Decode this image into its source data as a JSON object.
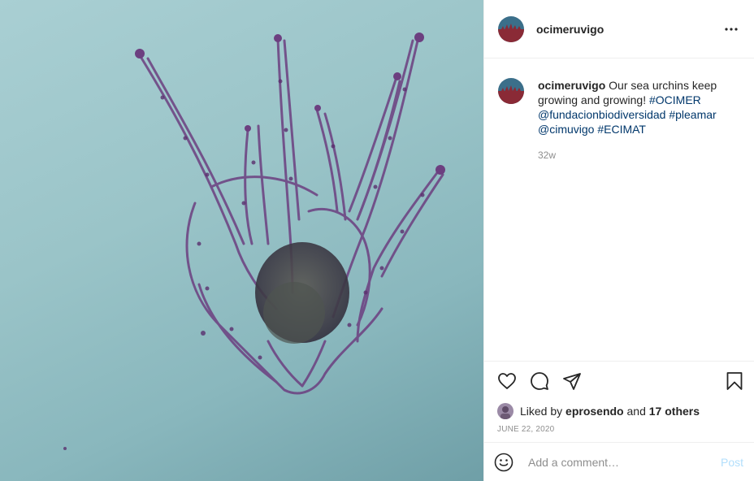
{
  "post": {
    "username": "ocimeruvigo"
  },
  "caption": {
    "username": "ocimeruvigo",
    "text": " Our sea urchins keep growing and growing! ",
    "tags": [
      "#OCIMER",
      "@fundacionbiodiversidad",
      "#pleamar",
      "@cimuvigo",
      "#ECIMAT"
    ],
    "age": "32w"
  },
  "likes": {
    "prefix": "Liked by ",
    "user": "eprosendo",
    "joiner": " and ",
    "others": "17 others"
  },
  "date": "JUNE 22, 2020",
  "comment_box": {
    "placeholder": "Add a comment…",
    "post_label": "Post"
  },
  "colors": {
    "link": "#00376b",
    "post_disabled": "#b2dffc",
    "photo_bg": "#9ac4c8"
  },
  "icons": [
    "more-horizontal-icon",
    "heart-icon",
    "comment-icon",
    "share-icon",
    "bookmark-icon",
    "emoji-icon"
  ]
}
